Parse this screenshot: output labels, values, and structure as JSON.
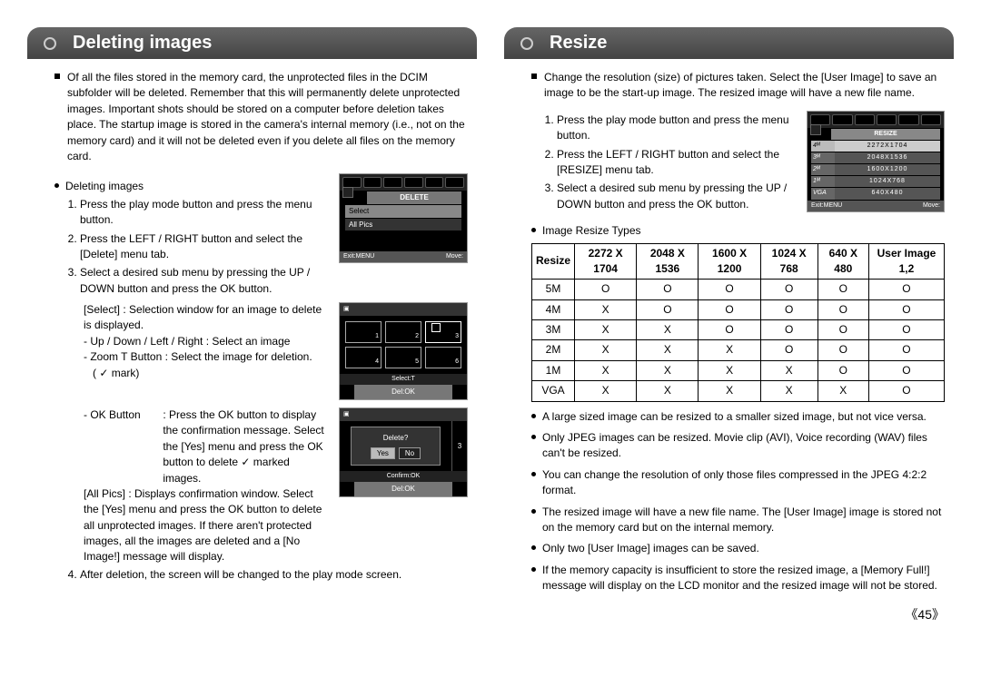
{
  "page_number": "45",
  "left": {
    "title": "Deleting images",
    "intro": "Of all the files stored in the memory card, the unprotected files in the DCIM subfolder will be deleted. Remember that this will permanently delete unprotected images. Important shots should be stored on a computer before deletion takes place. The startup image is stored in the camera's internal memory (i.e., not on the memory card) and it will not be deleted even if you delete all files on the memory card.",
    "proc_title": "Deleting images",
    "steps": [
      "Press the play mode button and press the menu button.",
      "Press the LEFT / RIGHT button and select the [Delete] menu tab.",
      "Select a desired sub menu by pressing the UP / DOWN button and press the OK button."
    ],
    "select_label": "[Select] : Selection window for an image to delete is displayed.",
    "nav_line": "- Up / Down / Left / Right : Select an image",
    "zoom_line": "- Zoom T Button : Select the image for deletion.",
    "check_mark": "(  ✓  mark)",
    "ok_label": "- OK Button",
    "ok_desc": ": Press the OK button to display the confirmation message. Select the [Yes] menu and press the OK button to delete ✓ marked images.",
    "allpics_label": "[All Pics] : Displays confirmation window. Select the [Yes] menu and press the OK button to delete all unprotected images. If there aren't protected images, all the images are deleted and a [No Image!] message will display.",
    "step4": "After deletion, the screen will be changed to the play mode screen.",
    "lcd1": {
      "title": "DELETE",
      "row1": "Select",
      "row2": "All Pics",
      "foot_l": "Exit:MENU",
      "foot_r": "Move:"
    },
    "lcd2": {
      "n1": "1",
      "n2": "2",
      "n3": "3",
      "n4": "4",
      "n5": "5",
      "n6": "6",
      "mid": "Select:T",
      "bar": "Del:OK"
    },
    "lcd3": {
      "q": "Delete?",
      "yes": "Yes",
      "no": "No",
      "side3": "3",
      "conf": "Confirm:OK",
      "bar": "Del:OK"
    }
  },
  "right": {
    "title": "Resize",
    "intro": "Change the resolution (size) of pictures taken. Select the [User Image] to save an image to be the start-up image. The resized image will have a new file name.",
    "steps": [
      "Press the play mode button and press the menu button.",
      "Press the LEFT /  RIGHT button and select the [RESIZE] menu tab.",
      "Select a desired sub menu by pressing the UP / DOWN button and press the OK button."
    ],
    "lcd": {
      "title": "RESIZE",
      "rows": [
        {
          "lbl": "4ᴹ",
          "val": "2272X1704",
          "sel": true
        },
        {
          "lbl": "3ᴹ",
          "val": "2048X1536"
        },
        {
          "lbl": "2ᴹ",
          "val": "1600X1200"
        },
        {
          "lbl": "1ᴹ",
          "val": "1024X768"
        },
        {
          "lbl": "VGA",
          "val": "640X480"
        }
      ],
      "foot_l": "Exit:MENU",
      "foot_r": "Move:"
    },
    "types_title": "Image Resize Types",
    "table": {
      "head": [
        "Resize",
        "2272 X 1704",
        "2048 X 1536",
        "1600 X 1200",
        "1024 X 768",
        "640 X 480",
        "User Image 1,2"
      ],
      "rows": [
        [
          "5M",
          "O",
          "O",
          "O",
          "O",
          "O",
          "O"
        ],
        [
          "4M",
          "X",
          "O",
          "O",
          "O",
          "O",
          "O"
        ],
        [
          "3M",
          "X",
          "X",
          "O",
          "O",
          "O",
          "O"
        ],
        [
          "2M",
          "X",
          "X",
          "X",
          "O",
          "O",
          "O"
        ],
        [
          "1M",
          "X",
          "X",
          "X",
          "X",
          "O",
          "O"
        ],
        [
          "VGA",
          "X",
          "X",
          "X",
          "X",
          "X",
          "O"
        ]
      ]
    },
    "notes": [
      "A large sized image can be resized to a smaller sized image, but not vice versa.",
      "Only JPEG images can be resized. Movie clip (AVI), Voice recording (WAV) files can't be resized.",
      "You can change the resolution of only those files compressed in the JPEG 4:2:2 format.",
      "The resized image will have a new file name. The [User Image] image is stored not on the memory card but on the internal memory.",
      "Only two [User Image] images can be saved.",
      "If the memory capacity is insufficient to store the resized image, a [Memory Full!] message will display on the LCD monitor and the resized image will not be stored."
    ]
  },
  "chart_data": {
    "type": "table",
    "title": "Image Resize Types",
    "columns": [
      "Resize",
      "2272 X 1704",
      "2048 X 1536",
      "1600 X 1200",
      "1024 X 768",
      "640 X 480",
      "User Image 1,2"
    ],
    "rows": [
      {
        "Resize": "5M",
        "2272 X 1704": "O",
        "2048 X 1536": "O",
        "1600 X 1200": "O",
        "1024 X 768": "O",
        "640 X 480": "O",
        "User Image 1,2": "O"
      },
      {
        "Resize": "4M",
        "2272 X 1704": "X",
        "2048 X 1536": "O",
        "1600 X 1200": "O",
        "1024 X 768": "O",
        "640 X 480": "O",
        "User Image 1,2": "O"
      },
      {
        "Resize": "3M",
        "2272 X 1704": "X",
        "2048 X 1536": "X",
        "1600 X 1200": "O",
        "1024 X 768": "O",
        "640 X 480": "O",
        "User Image 1,2": "O"
      },
      {
        "Resize": "2M",
        "2272 X 1704": "X",
        "2048 X 1536": "X",
        "1600 X 1200": "X",
        "1024 X 768": "O",
        "640 X 480": "O",
        "User Image 1,2": "O"
      },
      {
        "Resize": "1M",
        "2272 X 1704": "X",
        "2048 X 1536": "X",
        "1600 X 1200": "X",
        "1024 X 768": "X",
        "640 X 480": "O",
        "User Image 1,2": "O"
      },
      {
        "Resize": "VGA",
        "2272 X 1704": "X",
        "2048 X 1536": "X",
        "1600 X 1200": "X",
        "1024 X 768": "X",
        "640 X 480": "X",
        "User Image 1,2": "O"
      }
    ]
  }
}
